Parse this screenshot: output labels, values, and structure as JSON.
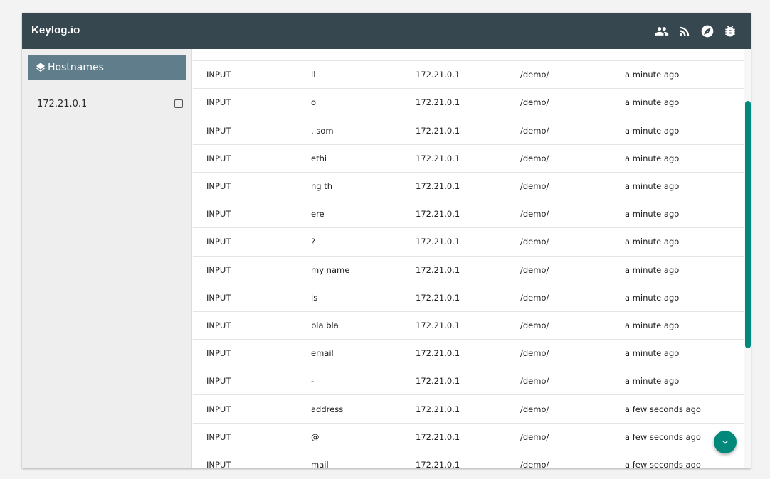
{
  "app": {
    "title": "Keylog.io"
  },
  "header": {
    "icons": [
      "people-icon",
      "rss-feed-icon",
      "compass-icon",
      "bug-icon"
    ]
  },
  "sidebar": {
    "title": "Hostnames",
    "hosts": [
      {
        "label": "172.21.0.1",
        "checked": false
      }
    ]
  },
  "table": {
    "rows": [
      {
        "type": "INPUT",
        "value": "ll",
        "ip": "172.21.0.1",
        "path": "/demo/",
        "time": "a minute ago"
      },
      {
        "type": "INPUT",
        "value": "o",
        "ip": "172.21.0.1",
        "path": "/demo/",
        "time": "a minute ago"
      },
      {
        "type": "INPUT",
        "value": ", som",
        "ip": "172.21.0.1",
        "path": "/demo/",
        "time": "a minute ago"
      },
      {
        "type": "INPUT",
        "value": "ethi",
        "ip": "172.21.0.1",
        "path": "/demo/",
        "time": "a minute ago"
      },
      {
        "type": "INPUT",
        "value": "ng th",
        "ip": "172.21.0.1",
        "path": "/demo/",
        "time": "a minute ago"
      },
      {
        "type": "INPUT",
        "value": "ere",
        "ip": "172.21.0.1",
        "path": "/demo/",
        "time": "a minute ago"
      },
      {
        "type": "INPUT",
        "value": "?",
        "ip": "172.21.0.1",
        "path": "/demo/",
        "time": "a minute ago"
      },
      {
        "type": "INPUT",
        "value": "my name",
        "ip": "172.21.0.1",
        "path": "/demo/",
        "time": "a minute ago"
      },
      {
        "type": "INPUT",
        "value": "is",
        "ip": "172.21.0.1",
        "path": "/demo/",
        "time": "a minute ago"
      },
      {
        "type": "INPUT",
        "value": "bla bla",
        "ip": "172.21.0.1",
        "path": "/demo/",
        "time": "a minute ago"
      },
      {
        "type": "INPUT",
        "value": "email",
        "ip": "172.21.0.1",
        "path": "/demo/",
        "time": "a minute ago"
      },
      {
        "type": "INPUT",
        "value": "-",
        "ip": "172.21.0.1",
        "path": "/demo/",
        "time": "a minute ago"
      },
      {
        "type": "INPUT",
        "value": "address",
        "ip": "172.21.0.1",
        "path": "/demo/",
        "time": "a few seconds ago"
      },
      {
        "type": "INPUT",
        "value": "@",
        "ip": "172.21.0.1",
        "path": "/demo/",
        "time": "a few seconds ago"
      },
      {
        "type": "INPUT",
        "value": "mail",
        "ip": "172.21.0.1",
        "path": "/demo/",
        "time": "a few seconds ago"
      }
    ]
  },
  "fab": {
    "icon": "chevron-down-icon"
  },
  "colors": {
    "topbar": "#37474f",
    "sidebar_header": "#607d8b",
    "accent": "#00897b"
  }
}
